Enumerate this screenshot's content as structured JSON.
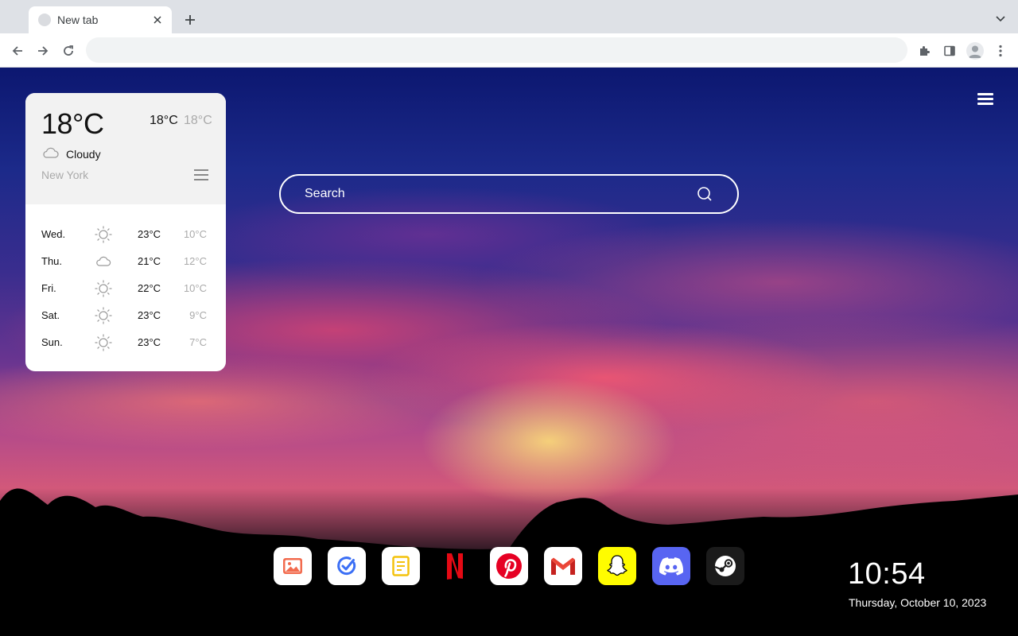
{
  "browser": {
    "tab": {
      "title": "New tab"
    },
    "omnibox": {
      "value": "",
      "placeholder": ""
    },
    "icons": {
      "back": "arrow-left-icon",
      "forward": "arrow-right-icon",
      "reload": "reload-icon",
      "extensions": "puzzle-icon",
      "side_panel": "side-panel-icon",
      "profile": "avatar-icon",
      "menu": "kebab-icon"
    }
  },
  "weather": {
    "current_temp": "18°C",
    "high": "18°C",
    "low": "18°C",
    "condition": "Cloudy",
    "city": "New York",
    "forecast": [
      {
        "day": "Wed.",
        "icon": "sun-icon",
        "high": "23°C",
        "low": "10°C"
      },
      {
        "day": "Thu.",
        "icon": "cloud-icon",
        "high": "21°C",
        "low": "12°C"
      },
      {
        "day": "Fri.",
        "icon": "sun-icon",
        "high": "22°C",
        "low": "10°C"
      },
      {
        "day": "Sat.",
        "icon": "sun-icon",
        "high": "23°C",
        "low": "9°C"
      },
      {
        "day": "Sun.",
        "icon": "sun-icon",
        "high": "23°C",
        "low": "7°C"
      }
    ]
  },
  "search": {
    "placeholder": "Search"
  },
  "dock": {
    "apps": [
      {
        "name": "photos",
        "icon": "image-icon",
        "bg": "#ffffff"
      },
      {
        "name": "todo",
        "icon": "check-circle-icon",
        "bg": "#ffffff"
      },
      {
        "name": "notes",
        "icon": "note-icon",
        "bg": "#ffffff"
      },
      {
        "name": "netflix",
        "icon": "netflix-icon",
        "bg": "transparent"
      },
      {
        "name": "pinterest",
        "icon": "pinterest-icon",
        "bg": "#ffffff"
      },
      {
        "name": "gmail",
        "icon": "gmail-icon",
        "bg": "#ffffff"
      },
      {
        "name": "snapchat",
        "icon": "snapchat-icon",
        "bg": "#fffc00"
      },
      {
        "name": "discord",
        "icon": "discord-icon",
        "bg": "#5865f2"
      },
      {
        "name": "steam",
        "icon": "steam-icon",
        "bg": "#1b1b1b"
      }
    ]
  },
  "clock": {
    "time": "10:54",
    "date": "Thursday, October 10, 2023"
  },
  "colors": {
    "netflix_red": "#e50914",
    "pinterest_red": "#e60023",
    "discord_blurple": "#5865f2",
    "snap_yellow": "#fffc00"
  }
}
